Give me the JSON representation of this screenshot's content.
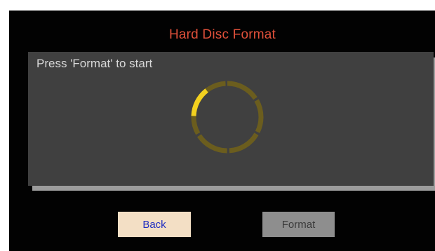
{
  "dialog": {
    "title": "Hard Disc Format",
    "status_text": "Press 'Format' to start"
  },
  "spinner": {
    "active_color": "#f3d11f",
    "track_color": "#6b5d1e"
  },
  "buttons": {
    "back_label": "Back",
    "format_label": "Format"
  },
  "colors": {
    "background": "#020202",
    "title": "#e0503a",
    "panel": "#404040"
  }
}
